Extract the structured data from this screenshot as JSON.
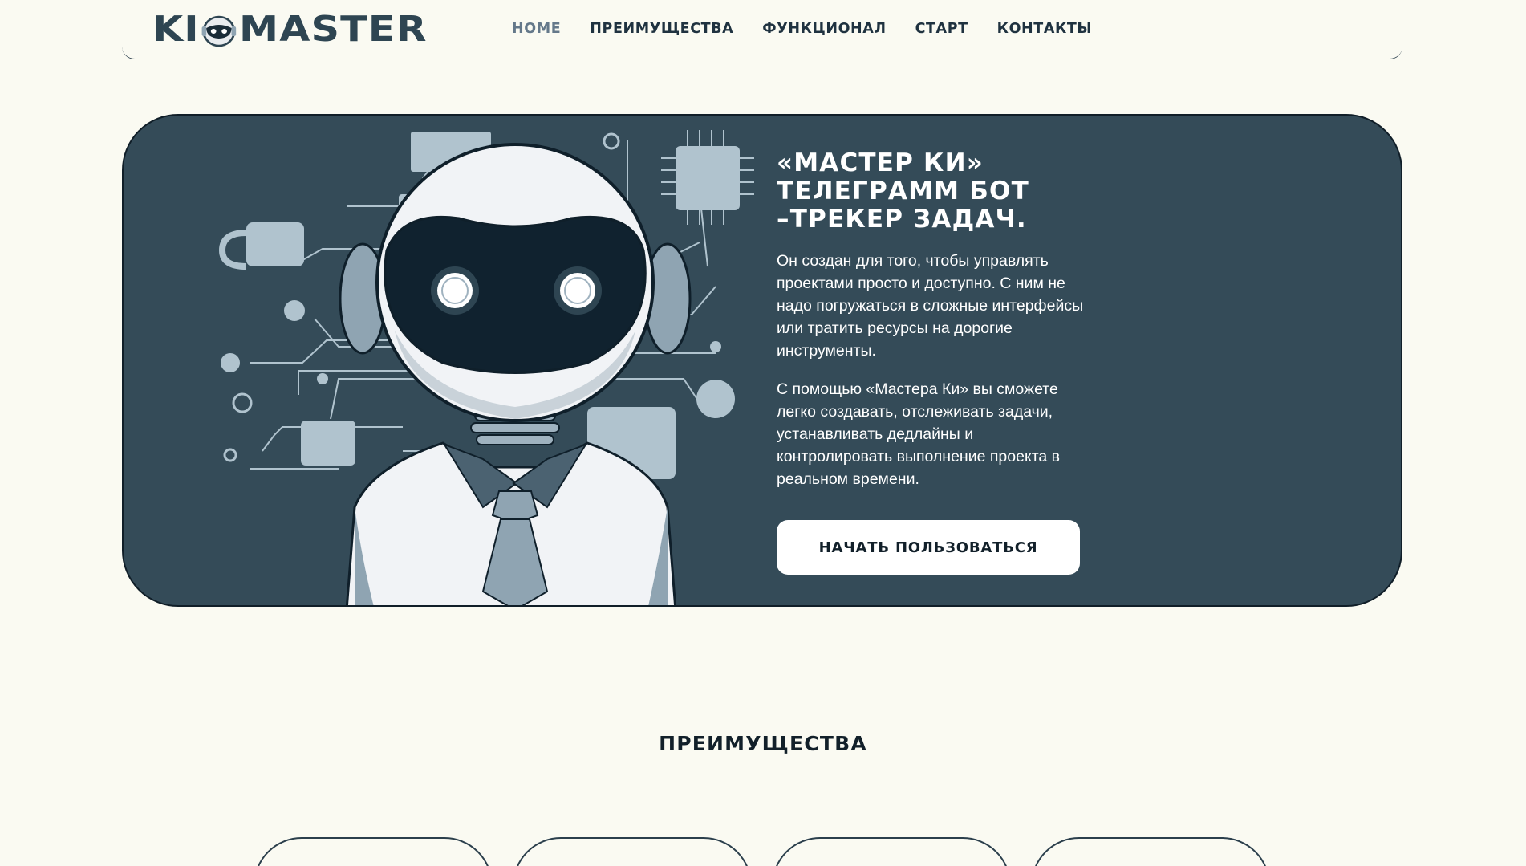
{
  "header": {
    "logo_left": "KI",
    "logo_right": "MASTER",
    "nav": [
      {
        "label": "HOME",
        "active": true
      },
      {
        "label": "ПРЕИМУЩЕСТВА",
        "active": false
      },
      {
        "label": "ФУНКЦИОНАЛ",
        "active": false
      },
      {
        "label": "СТАРТ",
        "active": false
      },
      {
        "label": "КОНТАКТЫ",
        "active": false
      }
    ]
  },
  "hero": {
    "title_line1": "«МАСТЕР КИ»",
    "title_line2": "ТЕЛЕГРАММ БОТ",
    "title_line3": "–ТРЕКЕР ЗАДАЧ.",
    "paragraph1": "Он создан для того, чтобы управлять проектами просто и доступно. С ним не надо погружаться в сложные интерфейсы или тратить ресурсы на дорогие инструменты.",
    "paragraph2": "С помощью «Мастера Ки» вы сможете легко создавать, отслеживать задачи, устанавливать дедлайны и контролировать выполнение проекта в реальном времени.",
    "cta_label": "НАЧАТЬ ПОЛЬЗОВАТЬСЯ"
  },
  "advantages": {
    "title": "ПРЕИМУЩЕСТВА"
  },
  "colors": {
    "background": "#fafaf2",
    "hero_bg": "#344b58",
    "accent_dark": "#12202a",
    "nav_active": "#64788a"
  }
}
